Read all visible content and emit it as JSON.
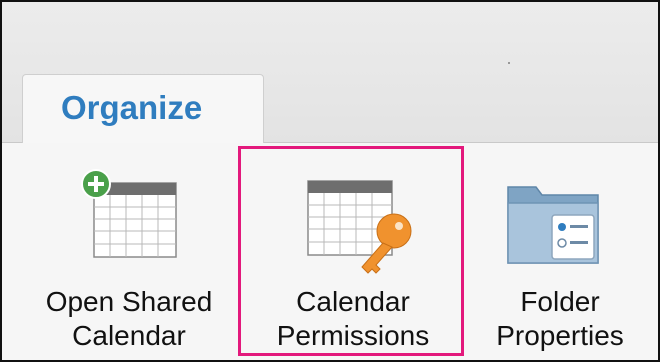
{
  "ribbon": {
    "tab_label": "Organize",
    "commands": [
      {
        "line1": "Open Shared",
        "line2": "Calendar",
        "icon": "calendar-add-icon"
      },
      {
        "line1": "Calendar",
        "line2": "Permissions",
        "icon": "calendar-key-icon"
      },
      {
        "line1": "Folder",
        "line2": "Properties",
        "icon": "folder-properties-icon"
      }
    ]
  },
  "colors": {
    "tab_text": "#2f7dbf",
    "highlight": "#e3197c",
    "add_badge": "#4aa04a",
    "key": "#f0922e"
  }
}
